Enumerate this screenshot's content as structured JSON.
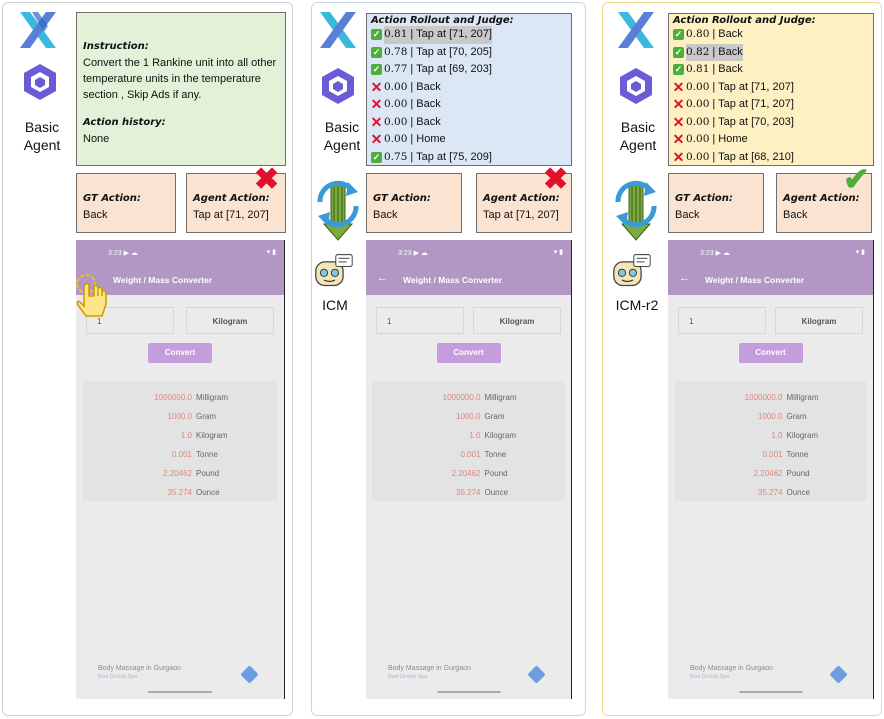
{
  "colors": {
    "instruction_bg": "#e4f1d9",
    "rollout_icm_bg": "#dbe7f5",
    "rollout_icmr2_bg": "#fdf0c3",
    "gt_bg": "#fbe3d2",
    "app_bar": "#b296c4",
    "convert_btn": "#c59ddc",
    "correct": "#4caf3c",
    "wrong": "#e0112a"
  },
  "panel1": {
    "agent_label_line1": "Basic",
    "agent_label_line2": "Agent",
    "instruction_title": "Instruction:",
    "instruction_text": "Convert the 1 Rankine unit into all other temperature units in the temperature section , Skip Ads if any.",
    "history_title": "Action history:",
    "history_text": "None",
    "gt_title": "GT Action:",
    "gt_value": "Back",
    "agent_title": "Agent Action:",
    "agent_value": "Tap at [71, 207]",
    "verdict_icon": "red-cross-icon"
  },
  "panel2": {
    "agent_label_line1": "Basic",
    "agent_label_line2": "Agent",
    "model_label": "ICM",
    "rollout_title": "Action Rollout and Judge:",
    "rollouts": [
      {
        "mark": "check",
        "score": "0.81",
        "action": "| Tap at [71, 207]",
        "highlight": true
      },
      {
        "mark": "check",
        "score": "0.78",
        "action": "| Tap at [70, 205]",
        "highlight": false
      },
      {
        "mark": "check",
        "score": "0.77",
        "action": "| Tap at [69, 203]",
        "highlight": false
      },
      {
        "mark": "cross",
        "score": "0.00",
        "action": "| Back",
        "highlight": false
      },
      {
        "mark": "cross",
        "score": "0.00",
        "action": "| Back",
        "highlight": false
      },
      {
        "mark": "cross",
        "score": "0.00",
        "action": "| Back",
        "highlight": false
      },
      {
        "mark": "cross",
        "score": "0.00",
        "action": "| Home",
        "highlight": false
      },
      {
        "mark": "check",
        "score": "0.75",
        "action": "| Tap at [75, 209]",
        "highlight": false
      }
    ],
    "gt_title": "GT Action:",
    "gt_value": "Back",
    "agent_title": "Agent Action:",
    "agent_value": "Tap at [71, 207]",
    "verdict_icon": "red-cross-icon"
  },
  "panel3": {
    "agent_label_line1": "Basic",
    "agent_label_line2": "Agent",
    "model_label": "ICM-r2",
    "rollout_title": "Action Rollout and Judge:",
    "rollouts": [
      {
        "mark": "check",
        "score": "0.80",
        "action": "| Back",
        "highlight": false
      },
      {
        "mark": "check",
        "score": "0.82",
        "action": "| Back",
        "highlight": true
      },
      {
        "mark": "check",
        "score": "0.81",
        "action": "| Back",
        "highlight": false
      },
      {
        "mark": "cross",
        "score": "0.00",
        "action": "| Tap at [71, 207]",
        "highlight": false
      },
      {
        "mark": "cross",
        "score": "0.00",
        "action": "| Tap at [71, 207]",
        "highlight": false
      },
      {
        "mark": "cross",
        "score": "0.00",
        "action": "| Tap at [70, 203]",
        "highlight": false
      },
      {
        "mark": "cross",
        "score": "0.00",
        "action": "| Home",
        "highlight": false
      },
      {
        "mark": "cross",
        "score": "0.00",
        "action": "| Tap at [68, 210]",
        "highlight": false
      }
    ],
    "gt_title": "GT Action:",
    "gt_value": "Back",
    "agent_title": "Agent Action:",
    "agent_value": "Back",
    "verdict_icon": "green-check-icon"
  },
  "phone": {
    "time": "3:23",
    "status_icons": "▶ ☁",
    "status_right": "▾ ▮",
    "app_title": "Weight / Mass Converter",
    "back_glyph": "←",
    "input_value": "1",
    "unit_value": "Kilogram",
    "convert_label": "Convert",
    "results": [
      {
        "value": "1000000.0",
        "unit": "Milligram"
      },
      {
        "value": "1000.0",
        "unit": "Gram"
      },
      {
        "value": "1.0",
        "unit": "Kilogram"
      },
      {
        "value": "0.001",
        "unit": "Tonne"
      },
      {
        "value": "2.20462",
        "unit": "Pound"
      },
      {
        "value": "35.274",
        "unit": "Ounce"
      }
    ],
    "ad_title": "Body Massage in Gurgaon",
    "ad_subtitle": "Red Orchid Spa"
  }
}
